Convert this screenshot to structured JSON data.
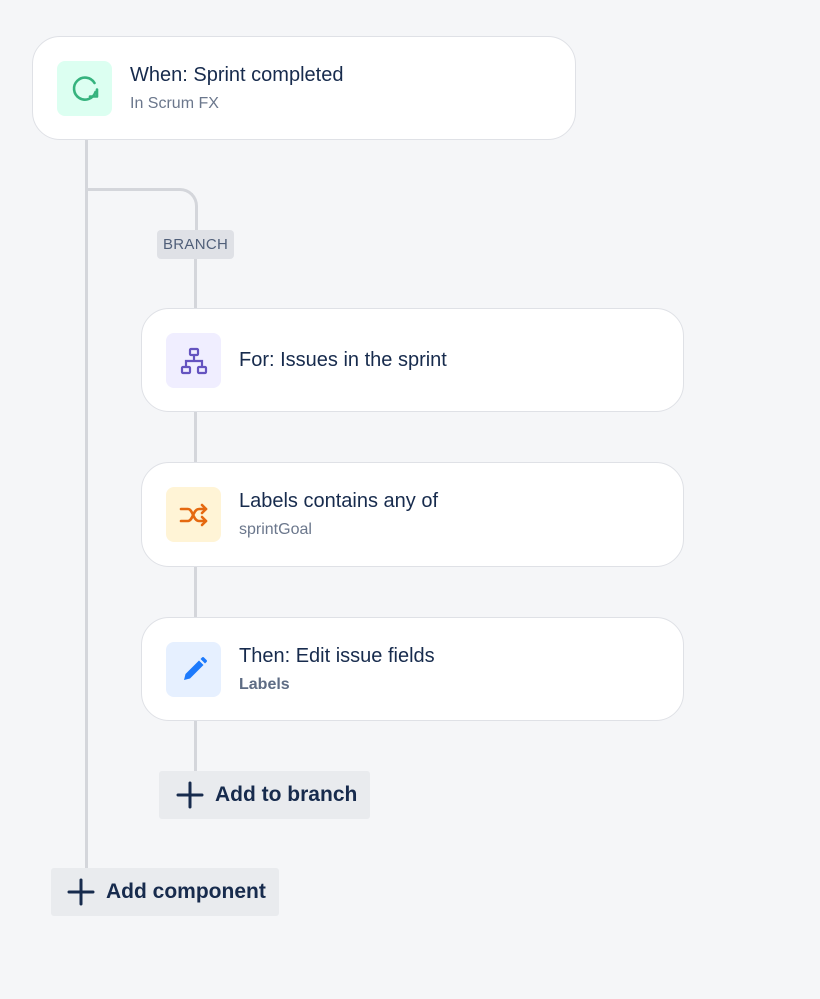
{
  "trigger": {
    "title": "When: Sprint completed",
    "subtitle": "In Scrum FX",
    "icon": "refresh-arrow-icon",
    "icon_color": "#36b37e",
    "tile_color": "#dcfff1"
  },
  "branch": {
    "badge": "BRANCH",
    "steps": [
      {
        "title": "For: Issues in the sprint",
        "subtitle": "",
        "icon": "hierarchy-icon",
        "icon_color": "#6554c0",
        "tile_color": "#f0eeff"
      },
      {
        "title": "Labels contains any of",
        "subtitle": "sprintGoal",
        "icon": "shuffle-icon",
        "icon_color": "#e56910",
        "tile_color": "#fff4d6"
      },
      {
        "title": "Then: Edit issue fields",
        "subtitle": "Labels",
        "icon": "pencil-icon",
        "icon_color": "#1d7afc",
        "tile_color": "#e6f0ff"
      }
    ],
    "add_label": "Add to branch"
  },
  "add_component_label": "Add component",
  "colors": {
    "background": "#f5f6f8",
    "connector": "#d4d6db",
    "button_bg": "#e9ebee"
  }
}
